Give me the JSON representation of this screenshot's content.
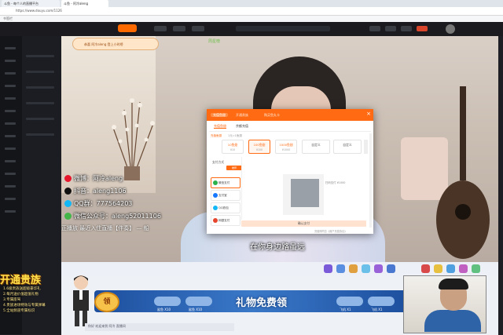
{
  "browser": {
    "tab1_title": "斗鱼 - 每个人的直播平台",
    "tab2_title": "斗鱼 - 阿冷aleng",
    "url": "https://www.douyu.com/1126",
    "bookmarks": "书签栏"
  },
  "stream": {
    "banner": "恭喜 阿冷aleng 登上小时榜",
    "tag": "周星榜",
    "socials": [
      {
        "platform": "weibo-icon",
        "text": "微博：阿冷aleng",
        "color": "#e6162d"
      },
      {
        "platform": "douyin-icon",
        "text": "抖音：aleng1106",
        "color": "#111111"
      },
      {
        "platform": "qq-icon",
        "text": "QQ群：777564203",
        "color": "#12b7f5"
      },
      {
        "platform": "wechat-icon",
        "text": "微信公众号：aleng52011106",
        "color": "#44b549"
      }
    ],
    "ticker": "正播放  最近入住直播【伴奏】 — 船",
    "subtitle": "在你身边路虽远"
  },
  "promo": {
    "headline": "开通贵族",
    "lines": [
      "1.6级贵族送超级豪华礼",
      "2.每月送价值超值礼物",
      "3.专属座驾",
      "4.贵族进场特效与专属弹幕",
      "5.全站频道专属标识"
    ],
    "ling_label": "领",
    "banner_text": "礼物免费领",
    "fish_labels": [
      "鲨鱼 X10",
      "鲨鱼 X10",
      "飞机 X1",
      "飞机 X1"
    ]
  },
  "bottom_strip": "你好 欢迎来到 阿冷 直播间",
  "dialog": {
    "tabs": [
      "充值鱼翅",
      "开通贵族",
      "购买鱼丸卡"
    ],
    "close": "×",
    "subtabs": [
      "充值鱼翅",
      "余额充值"
    ],
    "hint_orange": "充值鱼翅",
    "hint_gray": "1元=1鱼翅",
    "amounts": [
      {
        "value": "10鱼翅",
        "price": "¥10"
      },
      {
        "value": "100鱼翅",
        "price": "¥100"
      },
      {
        "value": "1000鱼翅",
        "price": "¥1000"
      },
      {
        "value": "自定义",
        "price": ""
      },
      {
        "value": "自定义",
        "price": ""
      }
    ],
    "pay_label": "支付方式",
    "pay_badge": "推荐",
    "pay_methods": [
      {
        "label": "微信支付",
        "color": "#2bb24c"
      },
      {
        "label": "支付宝",
        "color": "#1677ff"
      },
      {
        "label": "QQ钱包",
        "color": "#12b7f5"
      },
      {
        "label": "网银支付",
        "color": "#e5452c"
      },
      {
        "label": "其他支付",
        "color": "#ff8a1f"
      }
    ],
    "qr_note": "扫码支付 ¥1000",
    "bar_text": "确认支付",
    "footer": "充值即同意《用户充值协议》"
  }
}
